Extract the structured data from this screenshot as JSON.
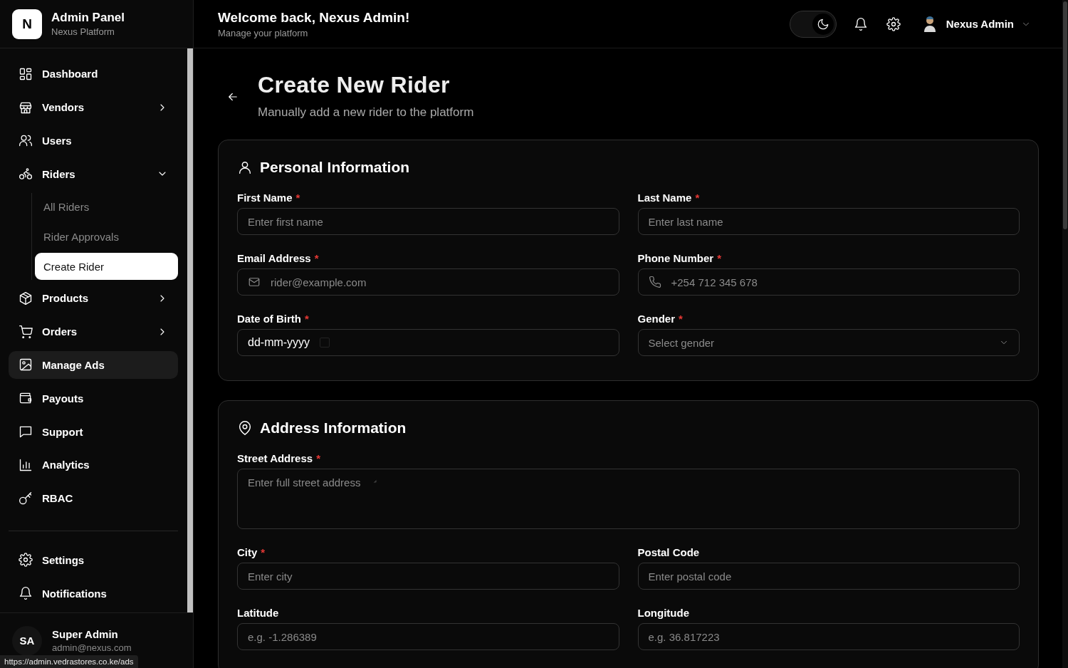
{
  "brand": {
    "logo": "N",
    "title": "Admin Panel",
    "subtitle": "Nexus Platform"
  },
  "sidebar": {
    "items": [
      {
        "label": "Dashboard",
        "kind": "link",
        "highlighted": false
      },
      {
        "label": "Vendors",
        "kind": "group",
        "expanded": false,
        "highlighted": false
      },
      {
        "label": "Users",
        "kind": "link",
        "highlighted": false
      },
      {
        "label": "Riders",
        "kind": "group",
        "expanded": true,
        "highlighted": false,
        "children": [
          {
            "label": "All Riders",
            "selected": false
          },
          {
            "label": "Rider Approvals",
            "selected": false
          },
          {
            "label": "Create Rider",
            "selected": true
          }
        ]
      },
      {
        "label": "Products",
        "kind": "group",
        "expanded": false,
        "highlighted": false
      },
      {
        "label": "Orders",
        "kind": "group",
        "expanded": false,
        "highlighted": false
      },
      {
        "label": "Manage Ads",
        "kind": "link",
        "highlighted": true
      },
      {
        "label": "Payouts",
        "kind": "link",
        "highlighted": false
      },
      {
        "label": "Support",
        "kind": "link",
        "highlighted": false
      },
      {
        "label": "Analytics",
        "kind": "link",
        "highlighted": false
      },
      {
        "label": "RBAC",
        "kind": "link",
        "highlighted": false
      }
    ],
    "bottom_items": [
      {
        "label": "Settings"
      },
      {
        "label": "Notifications"
      }
    ],
    "user": {
      "initials": "SA",
      "name": "Super Admin",
      "email": "admin@nexus.com"
    }
  },
  "header": {
    "title": "Welcome back, Nexus Admin!",
    "subtitle": "Manage your platform",
    "dark_mode": true,
    "user_name": "Nexus Admin"
  },
  "page": {
    "title": "Create New Rider",
    "subtitle": "Manually add a new rider to the platform"
  },
  "sections": [
    {
      "title": "Personal Information",
      "fields": [
        {
          "label": "First Name",
          "required_mark": "*",
          "kind": "text",
          "placeholder": "Enter first name"
        },
        {
          "label": "Last Name",
          "required_mark": "*",
          "kind": "text",
          "placeholder": "Enter last name"
        },
        {
          "label": "Email Address",
          "required_mark": "*",
          "kind": "email",
          "placeholder": "rider@example.com"
        },
        {
          "label": "Phone Number",
          "required_mark": "*",
          "kind": "phone",
          "placeholder": "+254 712 345 678"
        },
        {
          "label": "Date of Birth",
          "required_mark": "*",
          "kind": "date",
          "value": "dd-mm-yyyy"
        },
        {
          "label": "Gender",
          "required_mark": "*",
          "kind": "select",
          "placeholder": "Select gender"
        }
      ]
    },
    {
      "title": "Address Information",
      "fields": [
        {
          "label": "Street Address",
          "required_mark": "*",
          "kind": "textarea",
          "placeholder": "Enter full street address"
        },
        {
          "label": "City",
          "required_mark": "*",
          "kind": "text",
          "placeholder": "Enter city"
        },
        {
          "label": "Postal Code",
          "kind": "text",
          "placeholder": "Enter postal code"
        },
        {
          "label": "Latitude",
          "kind": "text",
          "placeholder": "e.g. -1.286389"
        },
        {
          "label": "Longitude",
          "kind": "text",
          "placeholder": "e.g. 36.817223"
        }
      ]
    }
  ],
  "status_url": "https://admin.vedrastores.co.ke/ads"
}
